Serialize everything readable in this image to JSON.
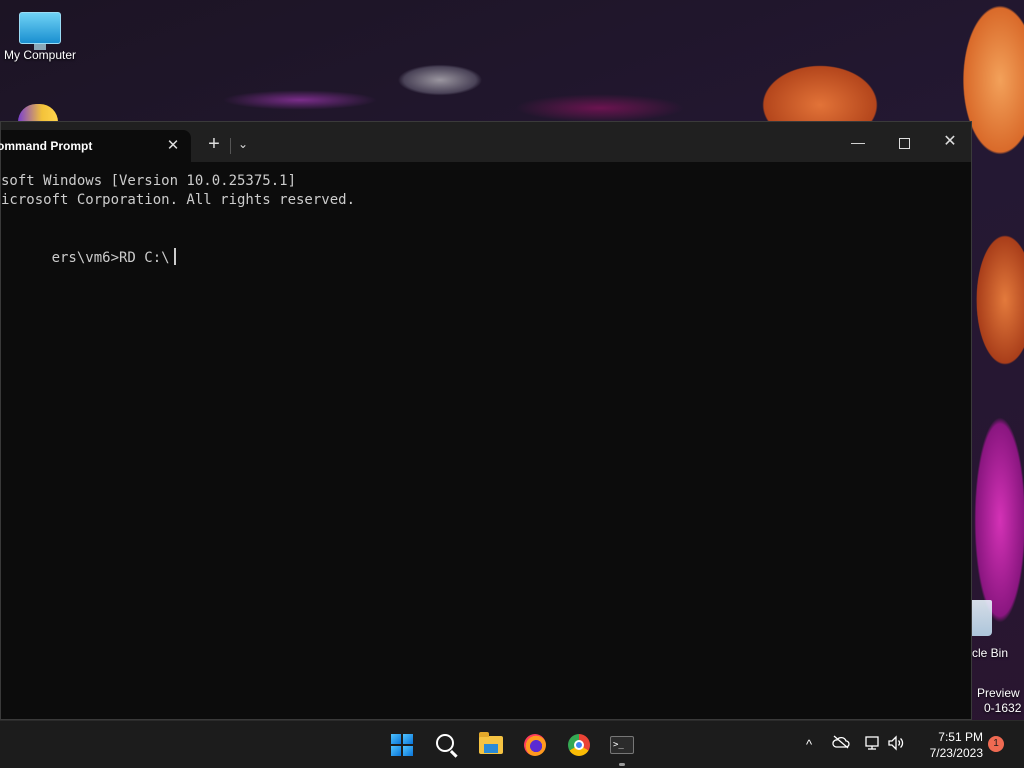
{
  "desktop": {
    "icons": [
      {
        "label": "My Computer"
      },
      {
        "label": "cle Bin"
      }
    ],
    "watermark": {
      "line1": "Preview",
      "line2": "0-1632"
    }
  },
  "terminal": {
    "tab_title": "ommand Prompt",
    "tab_close": "✕",
    "new_tab": "+",
    "tab_dropdown": "⌄",
    "minimize": "—",
    "close": "✕",
    "lines": [
      "soft Windows [Version 10.0.25375.1]",
      "icrosoft Corporation. All rights reserved.",
      "",
      "ers\\vm6>RD C:\\"
    ]
  },
  "taskbar": {
    "apps": [
      {
        "name": "start-icon"
      },
      {
        "name": "search-icon"
      },
      {
        "name": "file-explorer-icon"
      },
      {
        "name": "firefox-icon"
      },
      {
        "name": "chrome-icon"
      },
      {
        "name": "terminal-icon",
        "glyph": ">_"
      }
    ],
    "tray": {
      "chevron": "^",
      "time": "7:51 PM",
      "date": "7/23/2023",
      "notification_count": "1"
    }
  }
}
